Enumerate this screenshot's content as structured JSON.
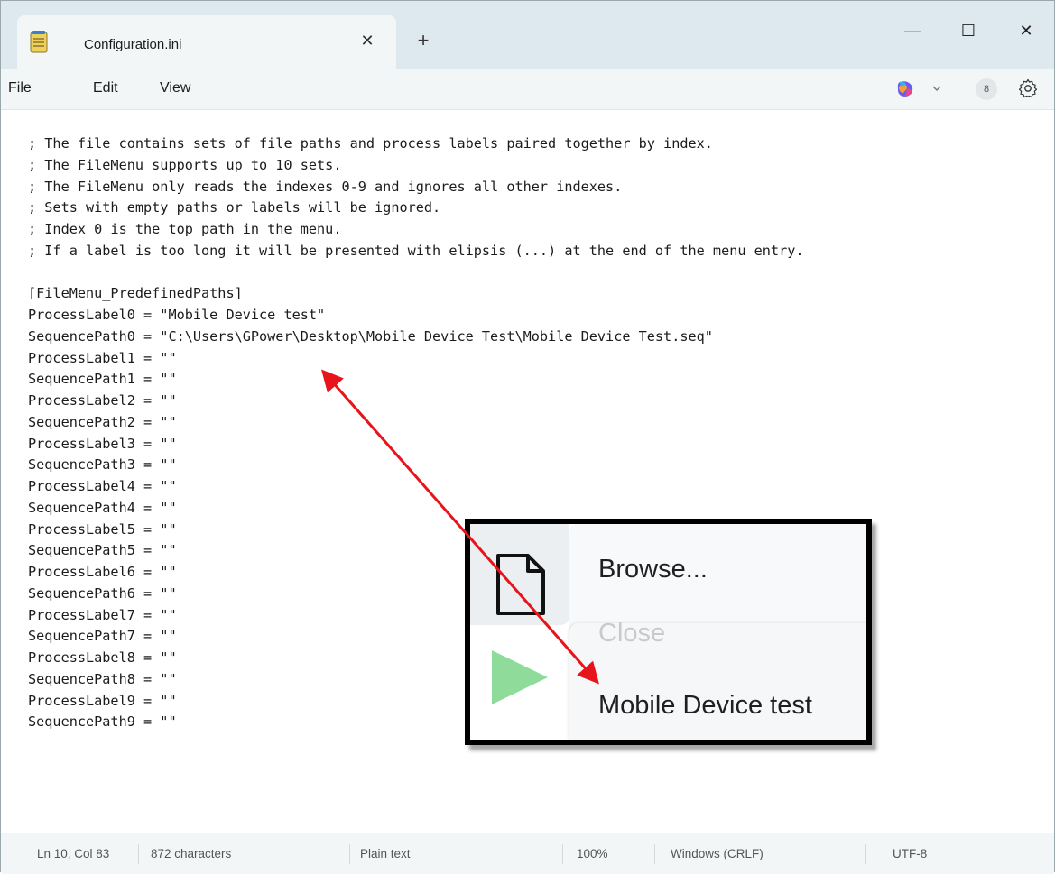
{
  "window": {
    "tab_title": "Configuration.ini",
    "controls": {
      "minimize": "—",
      "maximize": "☐",
      "close": "✕"
    }
  },
  "menubar": {
    "items": [
      {
        "label": "File"
      },
      {
        "label": "Edit"
      },
      {
        "label": "View"
      }
    ],
    "account_initial": "8"
  },
  "editor": {
    "lines": [
      "; The file contains sets of file paths and process labels paired together by index.",
      "; The FileMenu supports up to 10 sets.",
      "; The FileMenu only reads the indexes 0-9 and ignores all other indexes.",
      "; Sets with empty paths or labels will be ignored.",
      "; Index 0 is the top path in the menu.",
      "; If a label is too long it will be presented with elipsis (...) at the end of the menu entry.",
      "",
      "[FileMenu_PredefinedPaths]",
      "ProcessLabel0 = \"Mobile Device test\"",
      "SequencePath0 = \"C:\\Users\\GPower\\Desktop\\Mobile Device Test\\Mobile Device Test.seq\"",
      "ProcessLabel1 = \"\"",
      "SequencePath1 = \"\"",
      "ProcessLabel2 = \"\"",
      "SequencePath2 = \"\"",
      "ProcessLabel3 = \"\"",
      "SequencePath3 = \"\"",
      "ProcessLabel4 = \"\"",
      "SequencePath4 = \"\"",
      "ProcessLabel5 = \"\"",
      "SequencePath5 = \"\"",
      "ProcessLabel6 = \"\"",
      "SequencePath6 = \"\"",
      "ProcessLabel7 = \"\"",
      "SequencePath7 = \"\"",
      "ProcessLabel8 = \"\"",
      "SequencePath8 = \"\"",
      "ProcessLabel9 = \"\"",
      "SequencePath9 = \"\""
    ]
  },
  "statusbar": {
    "position": "Ln 10, Col 83",
    "characters": "872 characters",
    "file_type": "Plain text",
    "zoom": "100%",
    "line_ending": "Windows (CRLF)",
    "encoding": "UTF-8"
  },
  "inset_menu": {
    "items": [
      {
        "label": "Browse...",
        "enabled": true
      },
      {
        "label": "Close",
        "enabled": false
      },
      {
        "label": "Mobile Device test",
        "enabled": true
      }
    ],
    "play_color": "#8fdb9a",
    "annotation_color": "#e8141b"
  },
  "colors": {
    "titlebar": "#dde9ee",
    "menubar": "#f3f6f7"
  }
}
